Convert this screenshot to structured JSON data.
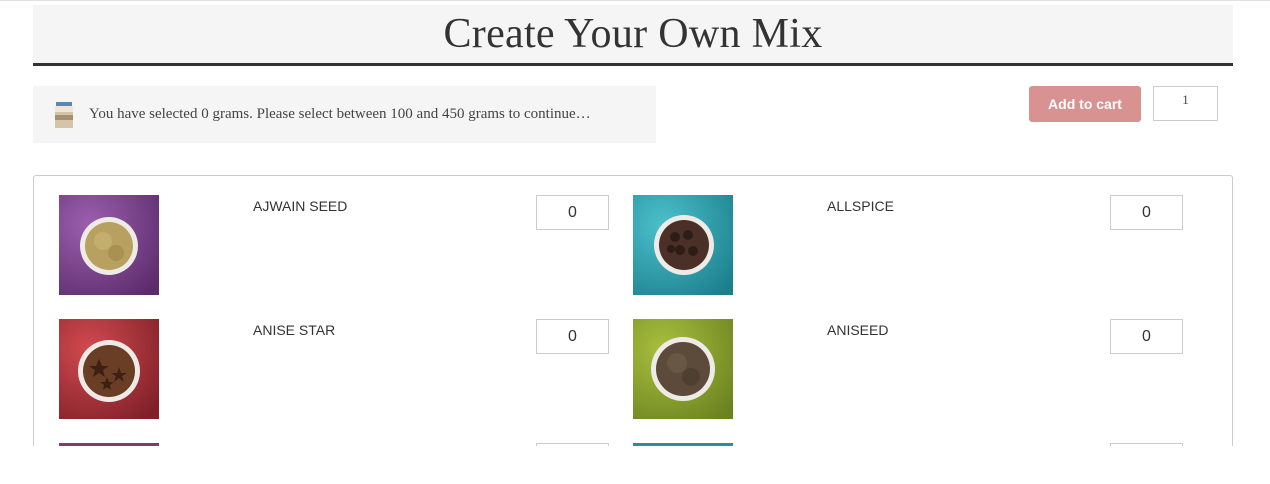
{
  "page": {
    "title": "Create Your Own Mix"
  },
  "notice": {
    "icon": "jar-icon",
    "text": "You have selected 0 grams. Please select between 100 and 450 grams to continue…"
  },
  "cart": {
    "add_label": "Add to cart",
    "quantity": "1",
    "button_color": "#d99292"
  },
  "products": [
    {
      "name": "AJWAIN SEED",
      "quantity": "0",
      "bg_color": "#7a3f8a",
      "spice_color": "#b39a52"
    },
    {
      "name": "ALLSPICE",
      "quantity": "0",
      "bg_color": "#2a9fae",
      "spice_color": "#3b2720"
    },
    {
      "name": "ANISE STAR",
      "quantity": "0",
      "bg_color": "#b8303a",
      "spice_color": "#5a3320"
    },
    {
      "name": "ANISEED",
      "quantity": "0",
      "bg_color": "#8aa22e",
      "spice_color": "#5c4b3a"
    }
  ],
  "partial_row": {
    "left_bg_color": "#7a3f6a",
    "right_bg_color": "#2a8f9a"
  }
}
